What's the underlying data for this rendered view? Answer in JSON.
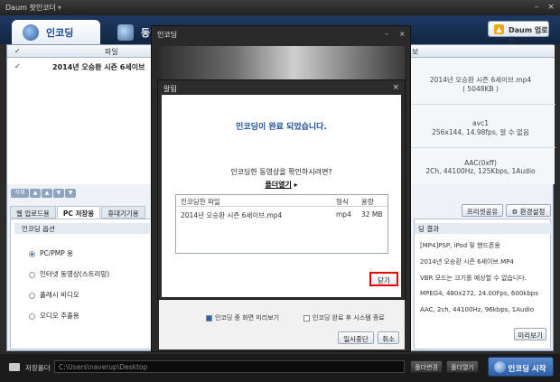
{
  "app": {
    "title": "Daum 팟인코더",
    "title_dropdown": "▾",
    "minimize": "–",
    "close": "×"
  },
  "tabs": {
    "encoding": "인코딩",
    "video_edit": "동영상편"
  },
  "upload_button": "Daum 업로드",
  "list": {
    "header_file": "파일",
    "header_info": "보",
    "row": {
      "check": "✓",
      "filename": "2014년 오승환 시즌 6세이브"
    },
    "file_info": "2014년 오승환 시즌 6세이브.mp4",
    "file_size": "( 5048KB )",
    "video_codec": "avc1",
    "video_info": "256x144, 14.98fps, 알 수 없음",
    "audio_codec": "AAC(0xff)",
    "audio_info": "2Ch, 44100Hz, 125Kbps, 1Audio"
  },
  "list_controls": [
    "삭제",
    "▲",
    "▲",
    "▼",
    "▼"
  ],
  "subtabs": [
    "웹 업로드용",
    "PC 저장용",
    "휴대기기용"
  ],
  "preset_share": "프리셋공유",
  "env_settings": "환경설정",
  "options": {
    "header": "인코딩 옵션",
    "items": [
      "PC/PMP 용",
      "인터넷 동영상(스트리밍)",
      "플래시 비디오",
      "오디오 추출용"
    ]
  },
  "result": {
    "header": "딩 결과",
    "lines": [
      "[MP4]PSP, iPod 및 핸드폰용",
      "2014년 오승환 시즌 6세이브.MP4",
      "VBR 모드는 크기를 예상할 수 없습니다.",
      "MPEG4, 480x272, 24.00Fps, 600kbps",
      "AAC, 2ch, 44100Hz, 96kbps, 1Audio"
    ],
    "preview": "미리보기"
  },
  "bottom": {
    "label": "저장폴더",
    "path": "C:\\Users\\naverup\\Desktop",
    "change_folder": "폴더변경",
    "open_folder": "폴더열기",
    "start": "인코딩 시작"
  },
  "enc_window": {
    "title": "인코딩",
    "minimize": "–",
    "close": "×",
    "preview_check": "인코딩 중 화면 미리보기",
    "shutdown_check": "인코딩 완료 후 시스템 종료",
    "pause": "일시중단",
    "cancel": "취소"
  },
  "alert": {
    "title": "알림",
    "close": "×",
    "message": "인코딩이 완료 되었습니다.",
    "sub": "인코딩한 동영상을 확인하시려면?",
    "folder_link": "폴더열기",
    "folder_link_arrow": "▸",
    "table": {
      "headers": [
        "인코딩한 파일",
        "형식",
        "용량"
      ],
      "row": [
        "2014년 오승환 시즌 6세이브.mp4",
        "mp4",
        "32 MB"
      ]
    },
    "close_button": "닫기"
  }
}
